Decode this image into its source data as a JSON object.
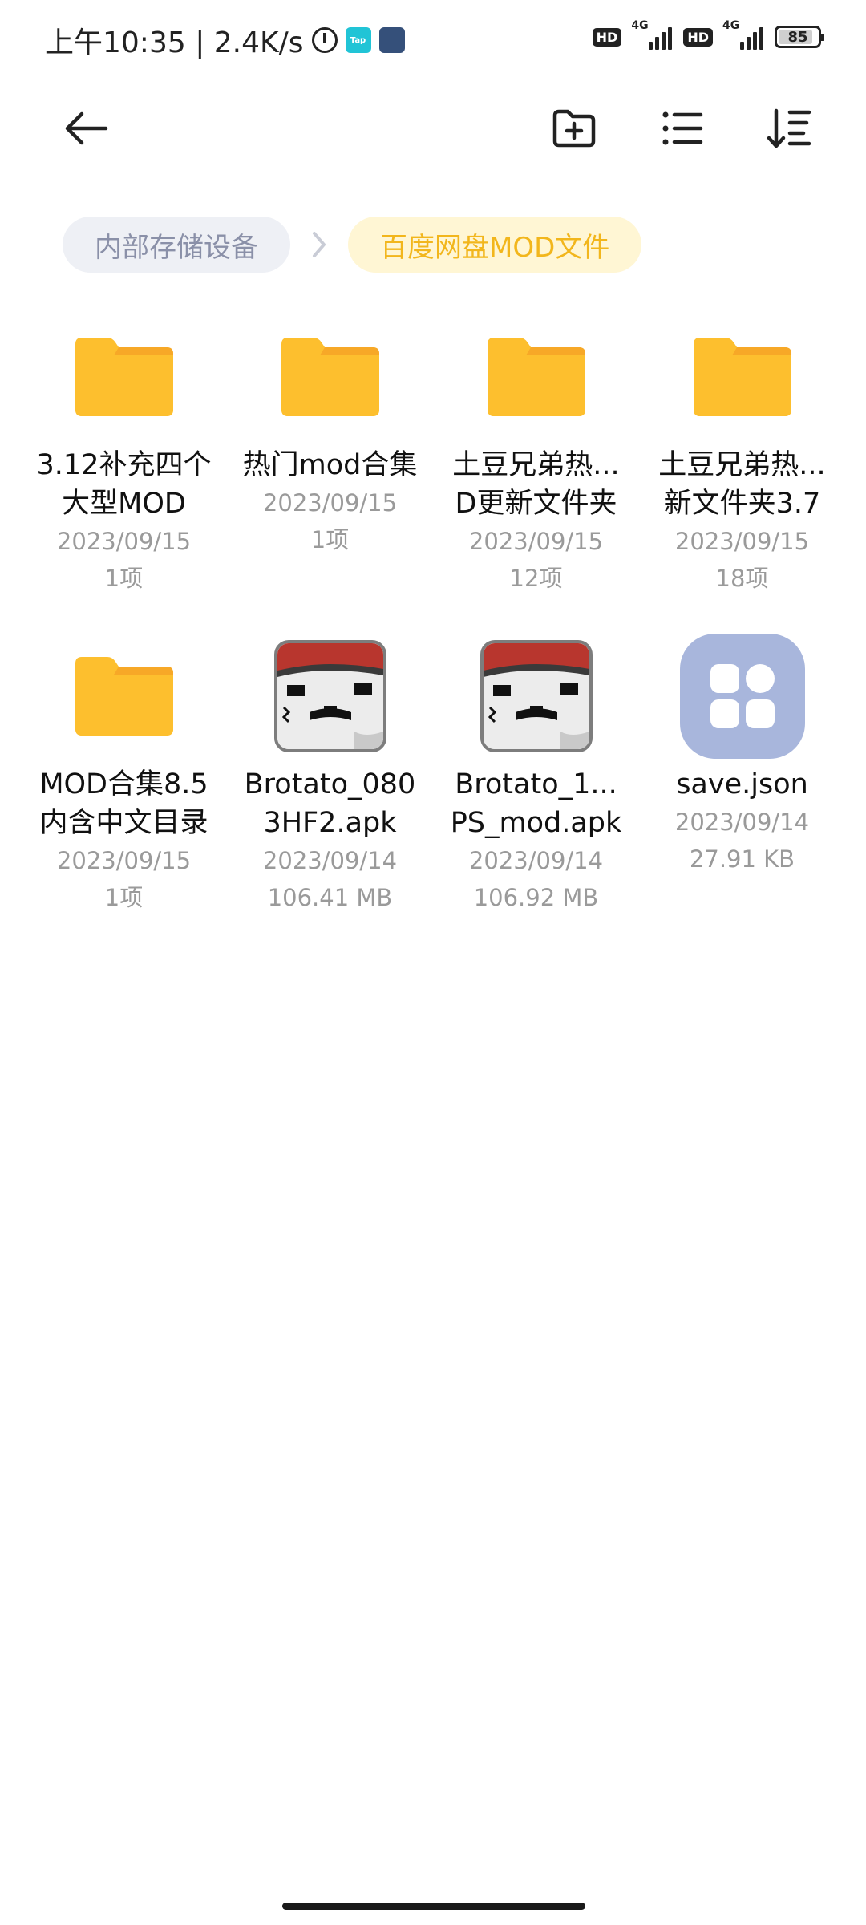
{
  "status_bar": {
    "time_speed": "上午10:35 | 2.4K/s",
    "taptap_label": "Tap",
    "hd1": "HD",
    "hd2": "HD",
    "net1": "4G",
    "net2": "4G",
    "battery": "85"
  },
  "toolbar": {
    "back_icon": "arrow-left-icon",
    "new_folder_icon": "folder-plus-icon",
    "view_icon": "list-view-icon",
    "sort_icon": "sort-icon"
  },
  "breadcrumb": {
    "root": "内部存储设备",
    "current": "百度网盘MOD文件"
  },
  "colors": {
    "folder": "#fdbf2e",
    "folder_tab": "#f7a827",
    "crumb_current_text": "#f2b61c",
    "crumb_current_bg": "#fff6d4",
    "json_icon_bg": "#a8b6dc"
  },
  "items": [
    {
      "type": "folder",
      "icon": "folder-icon",
      "name_line1": "3.12补充四个",
      "name_line2": "大型MOD",
      "date": "2023/09/15",
      "info": "1项"
    },
    {
      "type": "folder",
      "icon": "folder-icon",
      "name_line1": "热门mod合集",
      "name_line2": "",
      "date": "2023/09/15",
      "info": "1项"
    },
    {
      "type": "folder",
      "icon": "folder-icon",
      "name_line1": "土豆兄弟热...",
      "name_line2": "D更新文件夹",
      "date": "2023/09/15",
      "info": "12项"
    },
    {
      "type": "folder",
      "icon": "folder-icon",
      "name_line1": "土豆兄弟热...",
      "name_line2": "新文件夹3.7",
      "date": "2023/09/15",
      "info": "18项"
    },
    {
      "type": "folder",
      "icon": "folder-icon",
      "name_line1": "MOD合集8.5",
      "name_line2": "内含中文目录",
      "date": "2023/09/15",
      "info": "1项"
    },
    {
      "type": "apk",
      "icon": "brotato-app-icon",
      "name_line1": "Brotato_080",
      "name_line2": "3HF2.apk",
      "date": "2023/09/14",
      "info": "106.41 MB"
    },
    {
      "type": "apk",
      "icon": "brotato-app-icon",
      "name_line1": "Brotato_1...",
      "name_line2": "PS_mod.apk",
      "date": "2023/09/14",
      "info": "106.92 MB"
    },
    {
      "type": "json",
      "icon": "file-grid-icon",
      "name_line1": "save.json",
      "name_line2": "",
      "date": "2023/09/14",
      "info": "27.91 KB"
    }
  ]
}
